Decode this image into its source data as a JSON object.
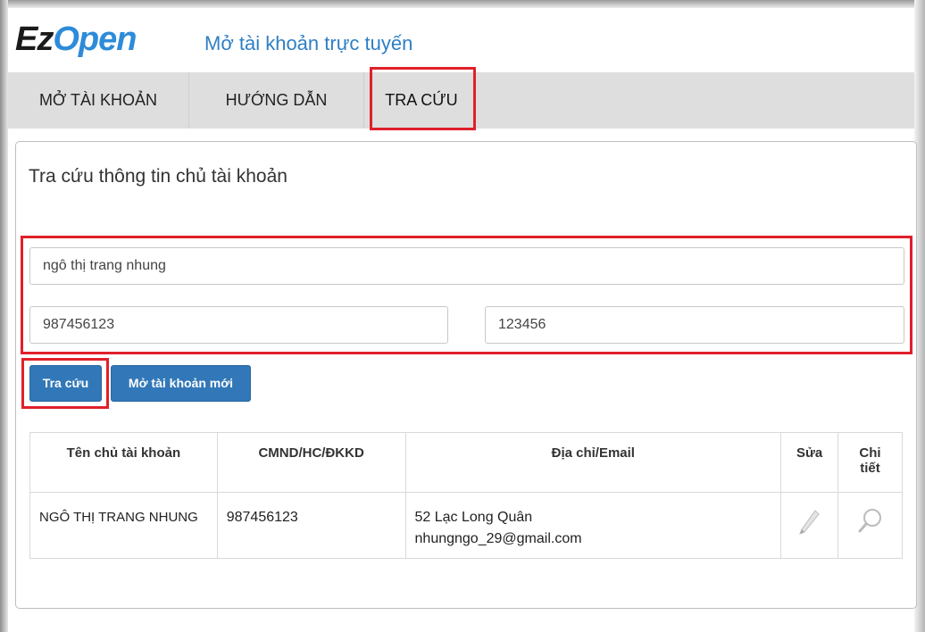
{
  "app": {
    "logo_ez": "Ez",
    "logo_open": "Open",
    "subtitle": "Mở tài khoản trực tuyến"
  },
  "nav": {
    "items": [
      {
        "label": "MỞ TÀI KHOẢN"
      },
      {
        "label": "HƯỚNG DẪN"
      },
      {
        "label": "TRA CỨU"
      }
    ],
    "active": "TRA CỨU"
  },
  "search": {
    "title": "Tra cứu thông tin chủ tài khoản",
    "name_value": "ngô thị trang nhung",
    "id_value": "987456123",
    "code_value": "123456",
    "search_button": "Tra cứu",
    "new_account_button": "Mở tài khoản mới"
  },
  "table": {
    "headers": [
      "Tên chủ tài khoản",
      "CMND/HC/ĐKKD",
      "Địa chỉ/Email",
      "Sửa",
      "Chi tiết"
    ],
    "rows": [
      {
        "name": "NGÔ THỊ TRANG NHUNG",
        "id": "987456123",
        "address": "52 Lạc Long Quân",
        "email": "nhungngo_29@gmail.com"
      }
    ]
  },
  "colors": {
    "accent": "#2e8bd9",
    "button": "#3278b8",
    "highlight": "#e0202a"
  },
  "icons": {
    "edit": "pencil-icon",
    "detail": "magnifier-icon"
  }
}
